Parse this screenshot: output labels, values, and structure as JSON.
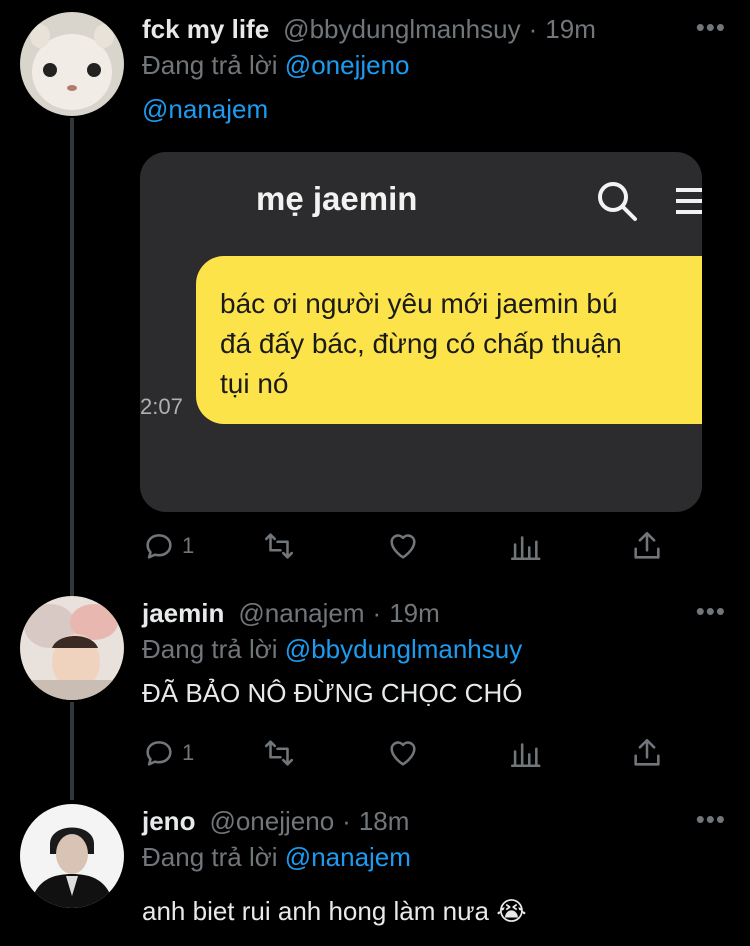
{
  "tweets": [
    {
      "name": "fck my life",
      "handle": "@bbydunglmanhsuy",
      "dot": "·",
      "time": "19m",
      "reply_prefix": "Đang trả lời",
      "reply_to": "@onejjeno",
      "text": "@nanajem",
      "reply_count": "1",
      "media": {
        "chat_title": "mẹ jaemin",
        "message_lines": [
          "bác ơi người yêu mới jaemin bú",
          "đá đấy bác, đừng có chấp thuận",
          "tụi nó"
        ],
        "message_time": "2:07"
      }
    },
    {
      "name": "jaemin",
      "handle": "@nanajem",
      "dot": "·",
      "time": "19m",
      "reply_prefix": "Đang trả lời",
      "reply_to": "@bbydunglmanhsuy",
      "text": "ĐÃ BẢO NÔ ĐỪNG CHỌC CHÓ",
      "reply_count": "1"
    },
    {
      "name": "jeno",
      "handle": "@onejjeno",
      "dot": "·",
      "time": "18m",
      "reply_prefix": "Đang trả lời",
      "reply_to": "@nanajem",
      "text": "anh biet rui anh hong làm nưa 😭"
    }
  ],
  "more_label": "•••",
  "colors": {
    "background": "#000000",
    "link": "#1d9bf0",
    "muted": "#71767b",
    "bubble": "#fde34a"
  }
}
